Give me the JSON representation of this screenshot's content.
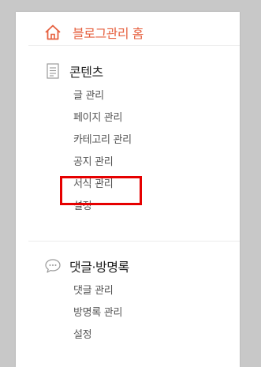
{
  "home": {
    "label": "블로그관리 홈",
    "icon": "home-icon",
    "color": "#e6603f"
  },
  "sections": [
    {
      "title": "콘텐츠",
      "icon": "document-icon",
      "items": [
        "글 관리",
        "페이지 관리",
        "카테고리 관리",
        "공지 관리",
        "서식 관리",
        "설정"
      ]
    },
    {
      "title": "댓글·방명록",
      "icon": "speech-bubble-icon",
      "items": [
        "댓글 관리",
        "방명록 관리",
        "설정"
      ]
    }
  ],
  "highlight": {
    "target": "서식 관리",
    "color": "#e60000"
  }
}
